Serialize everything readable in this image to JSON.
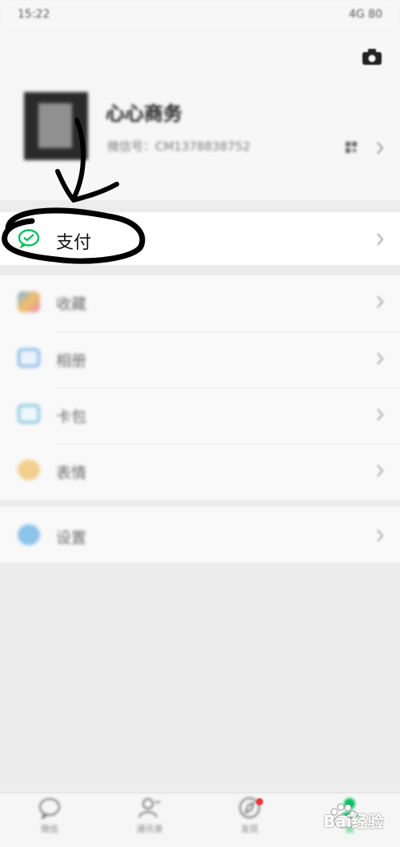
{
  "status_bar": {
    "time": "15:22",
    "right_text": "4G 80"
  },
  "profile": {
    "name": "心心商务",
    "id_text": "微信号：CM1378838752",
    "camera_icon": "camera-icon",
    "qr_icon": "qr-code-icon"
  },
  "pay": {
    "label": "支付",
    "icon": "wechat-pay-icon",
    "icon_color": "#07c160"
  },
  "menu": [
    {
      "label": "收藏",
      "icon": "favorites-icon",
      "color": "#f2b35a"
    },
    {
      "label": "相册",
      "icon": "album-icon",
      "color": "#4a90d9"
    },
    {
      "label": "卡包",
      "icon": "cards-icon",
      "color": "#4a90d9"
    },
    {
      "label": "表情",
      "icon": "emoji-icon",
      "color": "#f2b35a"
    }
  ],
  "settings": {
    "label": "设置",
    "icon": "settings-icon",
    "color": "#4a90d9"
  },
  "tabs": [
    {
      "label": "微信",
      "icon": "chat-icon"
    },
    {
      "label": "通讯录",
      "icon": "contacts-icon"
    },
    {
      "label": "发现",
      "icon": "discover-icon",
      "badge": true
    },
    {
      "label": "我",
      "icon": "me-icon",
      "active": true
    }
  ],
  "watermark": {
    "text": "Bai经验",
    "logo": "baidu-paw-logo"
  }
}
